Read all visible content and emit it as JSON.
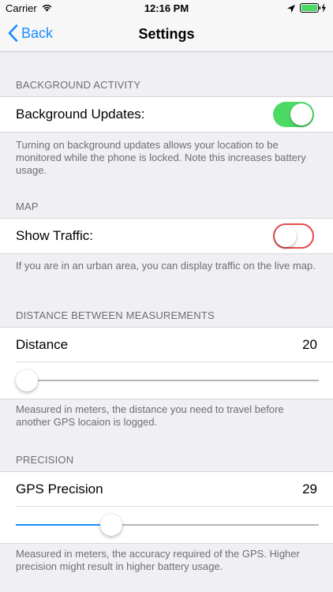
{
  "status_bar": {
    "carrier": "Carrier",
    "time": "12:16 PM",
    "wifi_icon": "wifi-icon",
    "location_icon": "location-arrow-icon",
    "battery_icon": "battery-charging-icon",
    "battery_color": "#4cd964"
  },
  "nav": {
    "back_label": "Back",
    "title": "Settings",
    "accent_color": "#1a8cff"
  },
  "sections": {
    "background": {
      "header": "BACKGROUND ACTIVITY",
      "label": "Background Updates:",
      "toggle_on": true,
      "footer": "Turning on background updates allows your location to be monitored while the phone is locked. Note this increases battery usage."
    },
    "map": {
      "header": "MAP",
      "label": "Show Traffic:",
      "toggle_on": false,
      "footer": "If you are in an urban area, you can display traffic on the live map."
    },
    "distance": {
      "header": "DISTANCE BETWEEN MEASUREMENTS",
      "label": "Distance",
      "value": "20",
      "slider_fraction": 0.0,
      "footer": "Measured in meters, the distance you need to travel before another GPS locaion is logged."
    },
    "precision": {
      "header": "PRECISION",
      "label": "GPS Precision",
      "value": "29",
      "slider_fraction": 0.3,
      "footer": "Measured in meters, the accuracy required of the GPS. Higher precision might result in higher battery usage."
    }
  }
}
